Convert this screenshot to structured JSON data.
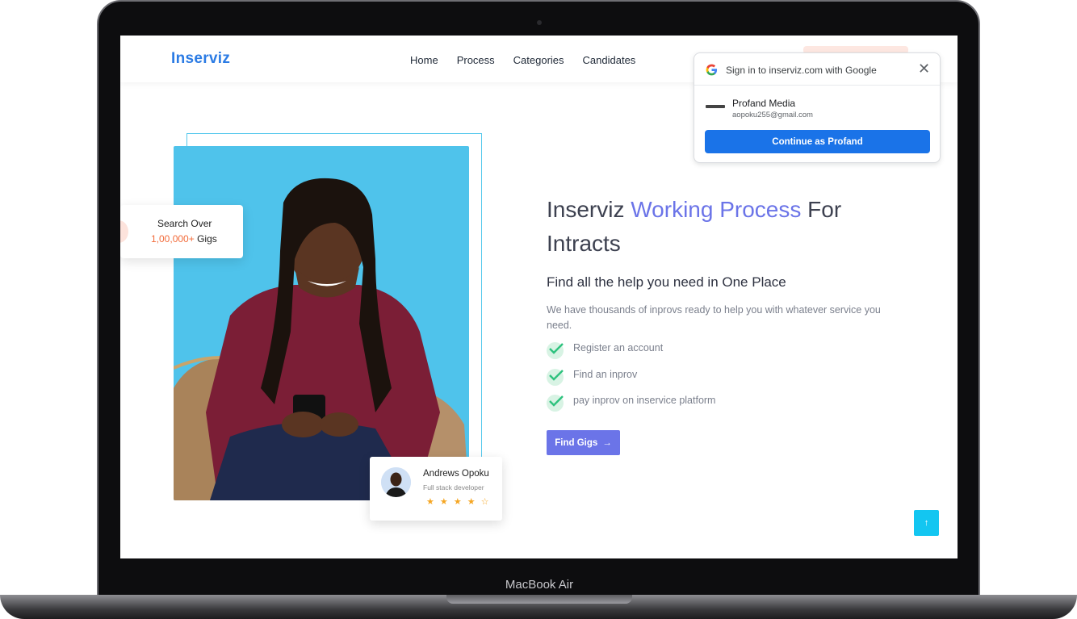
{
  "device": {
    "label": "MacBook Air"
  },
  "nav": {
    "logo": "Inserviz",
    "links": [
      "Home",
      "Process",
      "Categories",
      "Candidates"
    ]
  },
  "search_card": {
    "title": "Search Over",
    "count": "1,00,000+",
    "suffix": "Gigs"
  },
  "profile_card": {
    "name": "Andrews Opoku",
    "role": "Full stack developer",
    "stars": "★ ★ ★ ★ ☆"
  },
  "hero": {
    "heading_pre": "Inserviz ",
    "heading_highlight": "Working Process",
    "heading_post": " For Intracts",
    "subheading": "Find all the help you need in One Place",
    "paragraph": "We have thousands of inprovs ready to help you with whatever service you need.",
    "checklist": [
      "Register an account",
      "Find an inprov",
      "pay inprov on inservice platform"
    ],
    "button_label": "Find Gigs",
    "button_icon": "arrow-right-icon"
  },
  "scroll_top": {
    "icon": "arrow-up-icon",
    "glyph": "↑"
  },
  "google_signin": {
    "title": "Sign in to inserviz.com with Google",
    "account_name": "Profand Media",
    "account_email": "aopoku255@gmail.com",
    "continue_label": "Continue as Profand"
  },
  "colors": {
    "brand_blue": "#2b7be4",
    "accent_purple": "#6b74e8",
    "photo_bg": "#4fc3eb",
    "orange_accent": "#f26b3a",
    "google_blue": "#1a73e8",
    "scroll_top_bg": "#13c6f1"
  }
}
